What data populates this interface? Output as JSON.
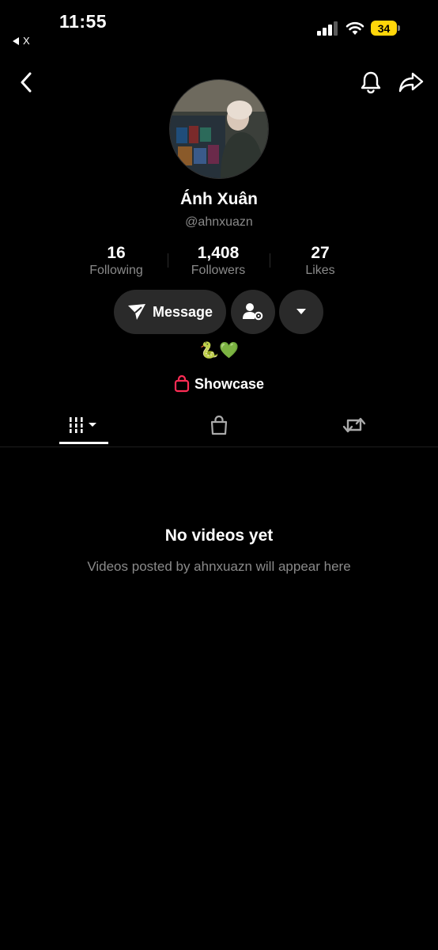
{
  "status_bar": {
    "time": "11:55",
    "back_app": "X",
    "battery": "34",
    "battery_color": "#ffd60a"
  },
  "header": {
    "back_icon": "chevron-left-icon",
    "bell_icon": "bell-icon",
    "share_icon": "share-arrow-icon"
  },
  "profile": {
    "name": "Ánh Xuân",
    "handle": "@ahnxuazn",
    "stats": [
      {
        "value": "16",
        "label": "Following"
      },
      {
        "value": "1,408",
        "label": "Followers"
      },
      {
        "value": "27",
        "label": "Likes"
      }
    ],
    "message_label": "Message",
    "bio_emoji": "🐍💚",
    "showcase_label": "Showcase",
    "showcase_icon_color": "#fe2c55"
  },
  "tabs": [
    {
      "icon": "videos-grid-icon",
      "selected": true
    },
    {
      "icon": "shopping-bag-icon",
      "selected": false
    },
    {
      "icon": "repost-icon",
      "selected": false
    }
  ],
  "empty_state": {
    "title": "No videos yet",
    "subtitle": "Videos posted by ahnxuazn will appear here"
  }
}
